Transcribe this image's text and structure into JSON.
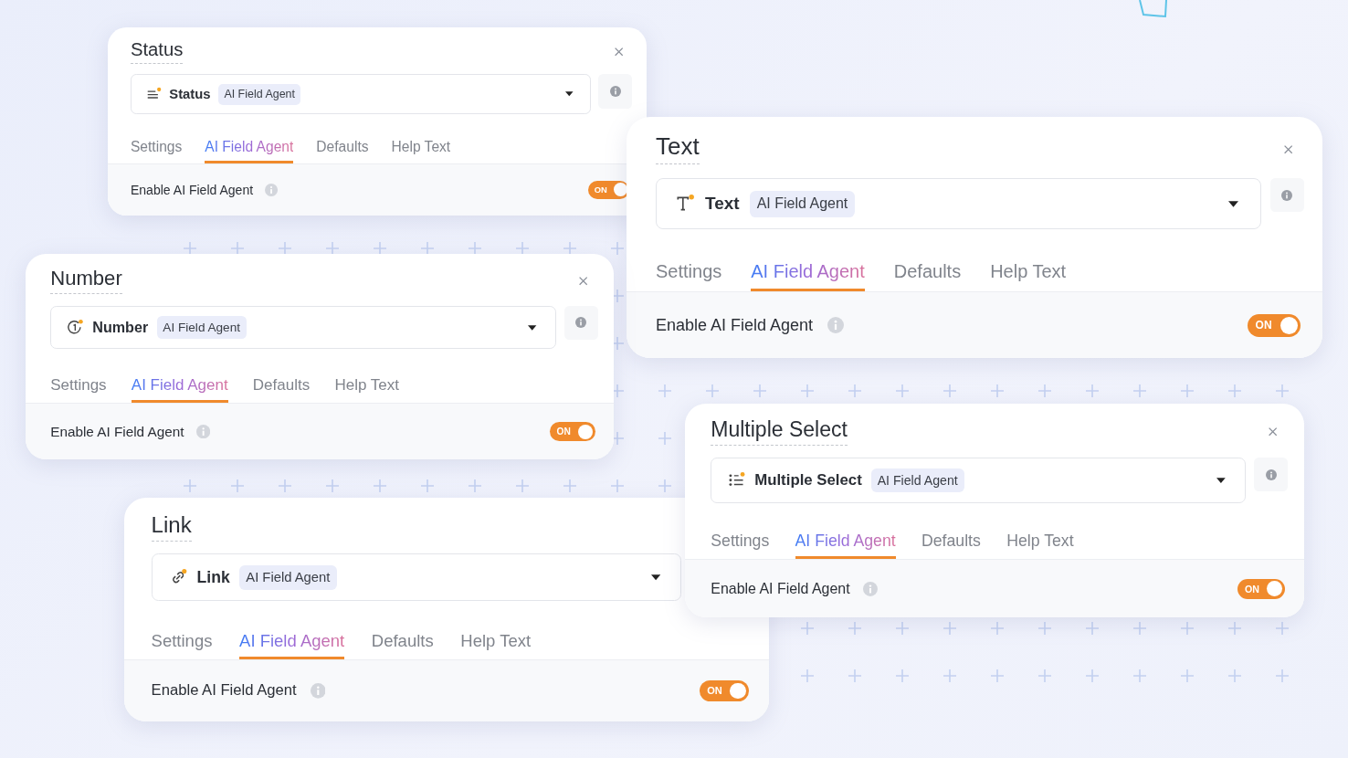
{
  "cards": [
    {
      "title": "Status",
      "kind": "status",
      "field_name": "Status",
      "badge": "AI Field Agent",
      "tabs": [
        {
          "label": "Settings",
          "selected": false
        },
        {
          "label": "AI Field Agent",
          "selected": true
        },
        {
          "label": "Defaults",
          "selected": false
        },
        {
          "label": "Help Text",
          "selected": false
        }
      ],
      "option": {
        "label": "Enable AI Field Agent",
        "on": true,
        "toggle_text": "ON"
      }
    },
    {
      "title": "Text",
      "kind": "text",
      "field_name": "Text",
      "badge": "AI Field Agent",
      "tabs": [
        {
          "label": "Settings",
          "selected": false
        },
        {
          "label": "AI Field Agent",
          "selected": true
        },
        {
          "label": "Defaults",
          "selected": false
        },
        {
          "label": "Help Text",
          "selected": false
        }
      ],
      "option": {
        "label": "Enable AI Field Agent",
        "on": true,
        "toggle_text": "ON"
      }
    },
    {
      "title": "Number",
      "kind": "number",
      "field_name": "Number",
      "badge": "AI Field Agent",
      "tabs": [
        {
          "label": "Settings",
          "selected": false
        },
        {
          "label": "AI Field Agent",
          "selected": true
        },
        {
          "label": "Defaults",
          "selected": false
        },
        {
          "label": "Help Text",
          "selected": false
        }
      ],
      "option": {
        "label": "Enable AI Field Agent",
        "on": true,
        "toggle_text": "ON"
      }
    },
    {
      "title": "Multiple Select",
      "kind": "multi",
      "field_name": "Multiple Select",
      "badge": "AI Field Agent",
      "tabs": [
        {
          "label": "Settings",
          "selected": false
        },
        {
          "label": "AI Field Agent",
          "selected": true
        },
        {
          "label": "Defaults",
          "selected": false
        },
        {
          "label": "Help Text",
          "selected": false
        }
      ],
      "option": {
        "label": "Enable AI Field Agent",
        "on": true,
        "toggle_text": "ON"
      }
    },
    {
      "title": "Link",
      "kind": "link",
      "field_name": "Link",
      "badge": "AI Field Agent",
      "tabs": [
        {
          "label": "Settings",
          "selected": false
        },
        {
          "label": "AI Field Agent",
          "selected": true
        },
        {
          "label": "Defaults",
          "selected": false
        },
        {
          "label": "Help Text",
          "selected": false
        }
      ],
      "option": {
        "label": "Enable AI Field Agent",
        "on": true,
        "toggle_text": "ON"
      }
    }
  ]
}
